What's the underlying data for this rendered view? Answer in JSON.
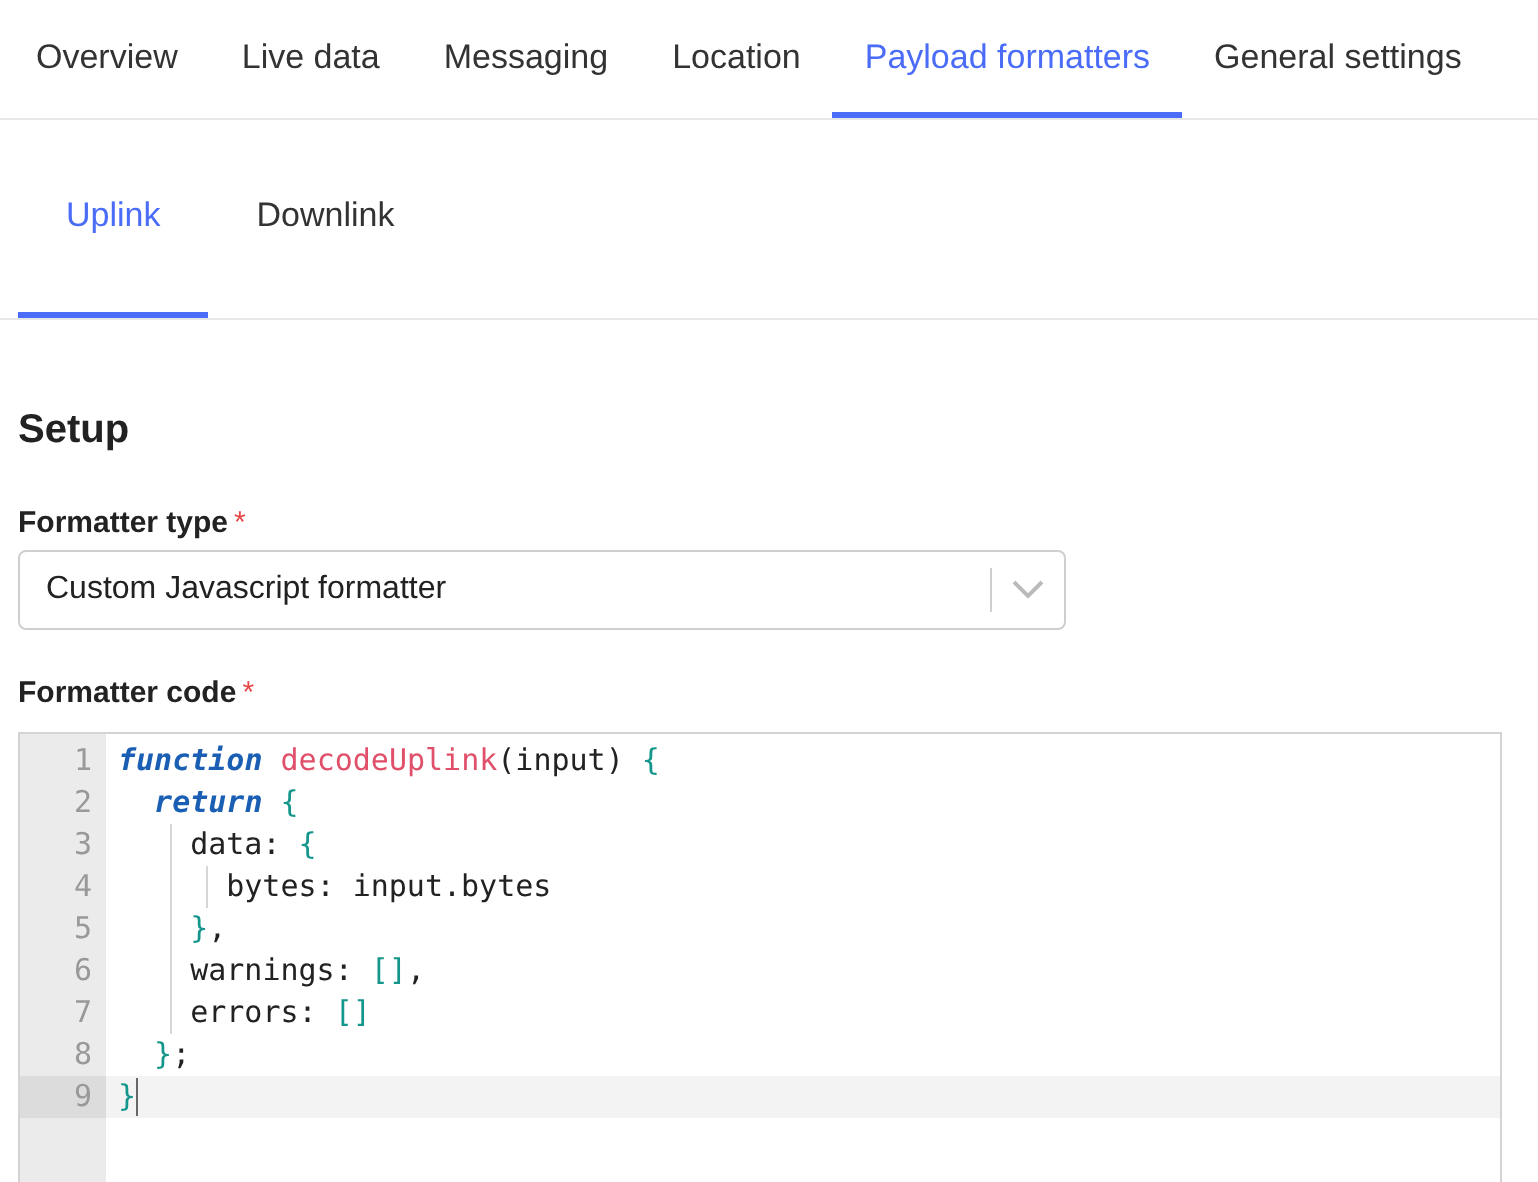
{
  "tabs": [
    {
      "label": "Overview",
      "selected": false
    },
    {
      "label": "Live data",
      "selected": false
    },
    {
      "label": "Messaging",
      "selected": false
    },
    {
      "label": "Location",
      "selected": false
    },
    {
      "label": "Payload formatters",
      "selected": true
    },
    {
      "label": "General settings",
      "selected": false
    }
  ],
  "subtabs": [
    {
      "label": "Uplink",
      "selected": true
    },
    {
      "label": "Downlink",
      "selected": false
    }
  ],
  "section_title": "Setup",
  "formatter_type": {
    "label": "Formatter type",
    "required_mark": "*",
    "value": "Custom Javascript formatter"
  },
  "formatter_code": {
    "label": "Formatter code",
    "required_mark": "*",
    "lines": [
      {
        "number": "1",
        "active": false,
        "tokens": [
          {
            "kind": "keyword",
            "text": "function "
          },
          {
            "kind": "name",
            "text": "decodeUplink"
          },
          {
            "kind": "plain",
            "text": "(input) "
          },
          {
            "kind": "bracket",
            "text": "{"
          }
        ],
        "children": [
          {
            "number": "2",
            "active": false,
            "tokens": [
              {
                "kind": "keyword",
                "text": "return "
              },
              {
                "kind": "bracket",
                "text": "{"
              }
            ],
            "children": [
              {
                "number": "3",
                "active": false,
                "tokens": [
                  {
                    "kind": "plain",
                    "text": "data: "
                  },
                  {
                    "kind": "bracket",
                    "text": "{"
                  }
                ],
                "children": [
                  {
                    "number": "4",
                    "active": false,
                    "tokens": [
                      {
                        "kind": "plain",
                        "text": "bytes: input.bytes"
                      }
                    ]
                  }
                ]
              },
              {
                "number": "5",
                "active": false,
                "tokens": [
                  {
                    "kind": "bracket",
                    "text": "}"
                  },
                  {
                    "kind": "plain",
                    "text": ","
                  }
                ]
              },
              {
                "number": "6",
                "active": false,
                "tokens": [
                  {
                    "kind": "plain",
                    "text": "warnings: "
                  },
                  {
                    "kind": "bracket",
                    "text": "[]"
                  },
                  {
                    "kind": "plain",
                    "text": ","
                  }
                ]
              },
              {
                "number": "7",
                "active": false,
                "tokens": [
                  {
                    "kind": "plain",
                    "text": "errors: "
                  },
                  {
                    "kind": "bracket",
                    "text": "[]"
                  }
                ]
              }
            ]
          },
          {
            "number": "8",
            "active": false,
            "tokens": [
              {
                "kind": "bracket",
                "text": "}"
              },
              {
                "kind": "plain",
                "text": ";"
              }
            ]
          }
        ]
      },
      {
        "number": "9",
        "active": true,
        "tokens": [
          {
            "kind": "bracket",
            "text": "}"
          }
        ]
      }
    ]
  }
}
